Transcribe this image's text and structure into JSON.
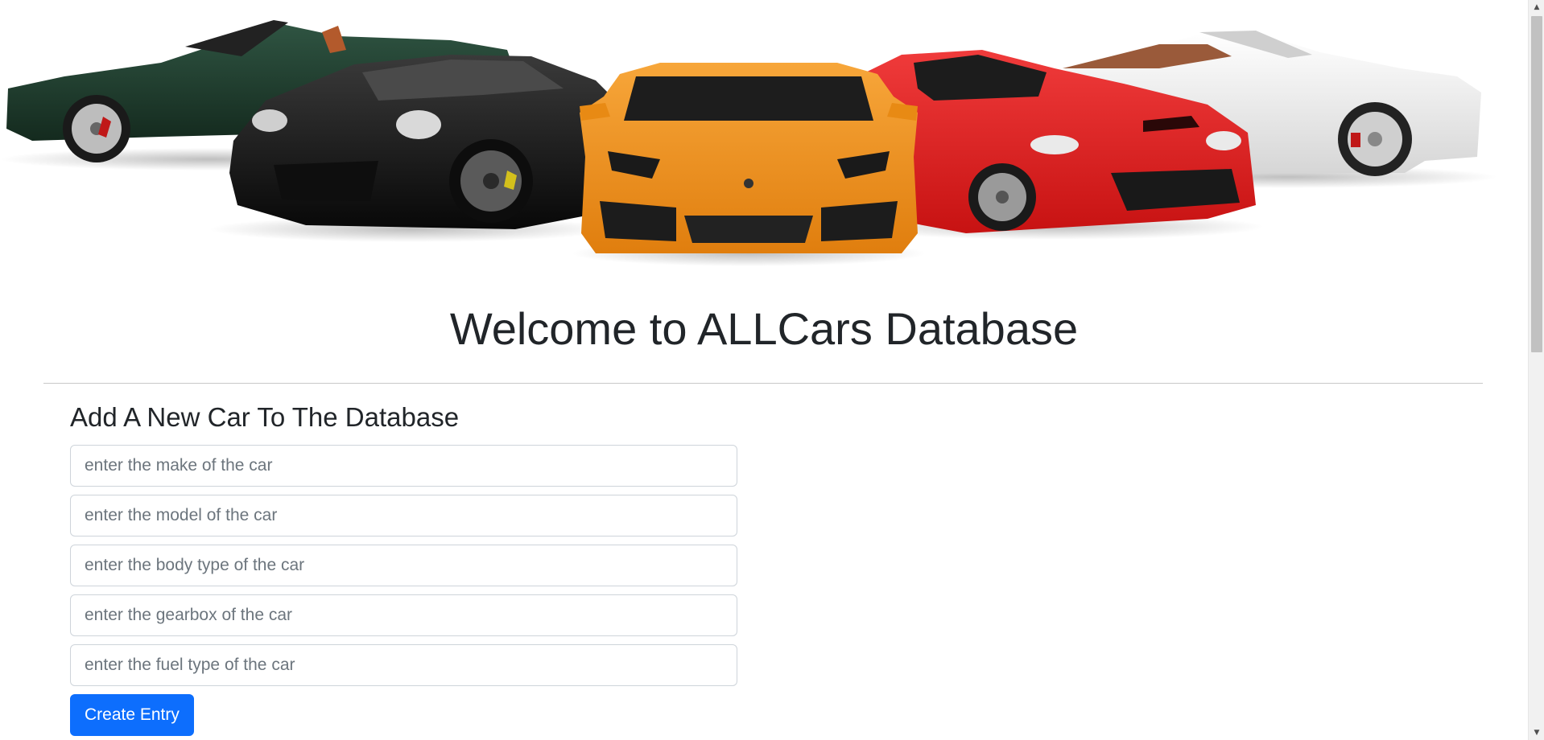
{
  "hero": {
    "image_name": "sports-cars-banner",
    "cars": [
      {
        "name": "green-convertible-car",
        "color": "#1f3a2b"
      },
      {
        "name": "black-coupe-car",
        "color": "#141414"
      },
      {
        "name": "orange-supercar",
        "color": "#f0901a"
      },
      {
        "name": "red-sports-car",
        "color": "#e21c1c"
      },
      {
        "name": "white-convertible-car",
        "color": "#ececec"
      }
    ]
  },
  "page": {
    "title": "Welcome to ALLCars Database"
  },
  "form": {
    "heading": "Add A New Car To The Database",
    "make_placeholder": "enter the make of the car",
    "model_placeholder": "enter the model of the car",
    "body_type_placeholder": "enter the body type of the car",
    "gearbox_placeholder": "enter the gearbox of the car",
    "fuel_type_placeholder": "enter the fuel type of the car",
    "make_value": "",
    "model_value": "",
    "body_type_value": "",
    "gearbox_value": "",
    "fuel_type_value": "",
    "submit_label": "Create Entry"
  },
  "colors": {
    "primary_button": "#0d6efd",
    "text": "#212529",
    "placeholder": "#6c757d",
    "input_border": "#ced4da"
  },
  "scrollbar": {
    "up_icon": "triangle-up-icon",
    "down_icon": "triangle-down-icon"
  }
}
